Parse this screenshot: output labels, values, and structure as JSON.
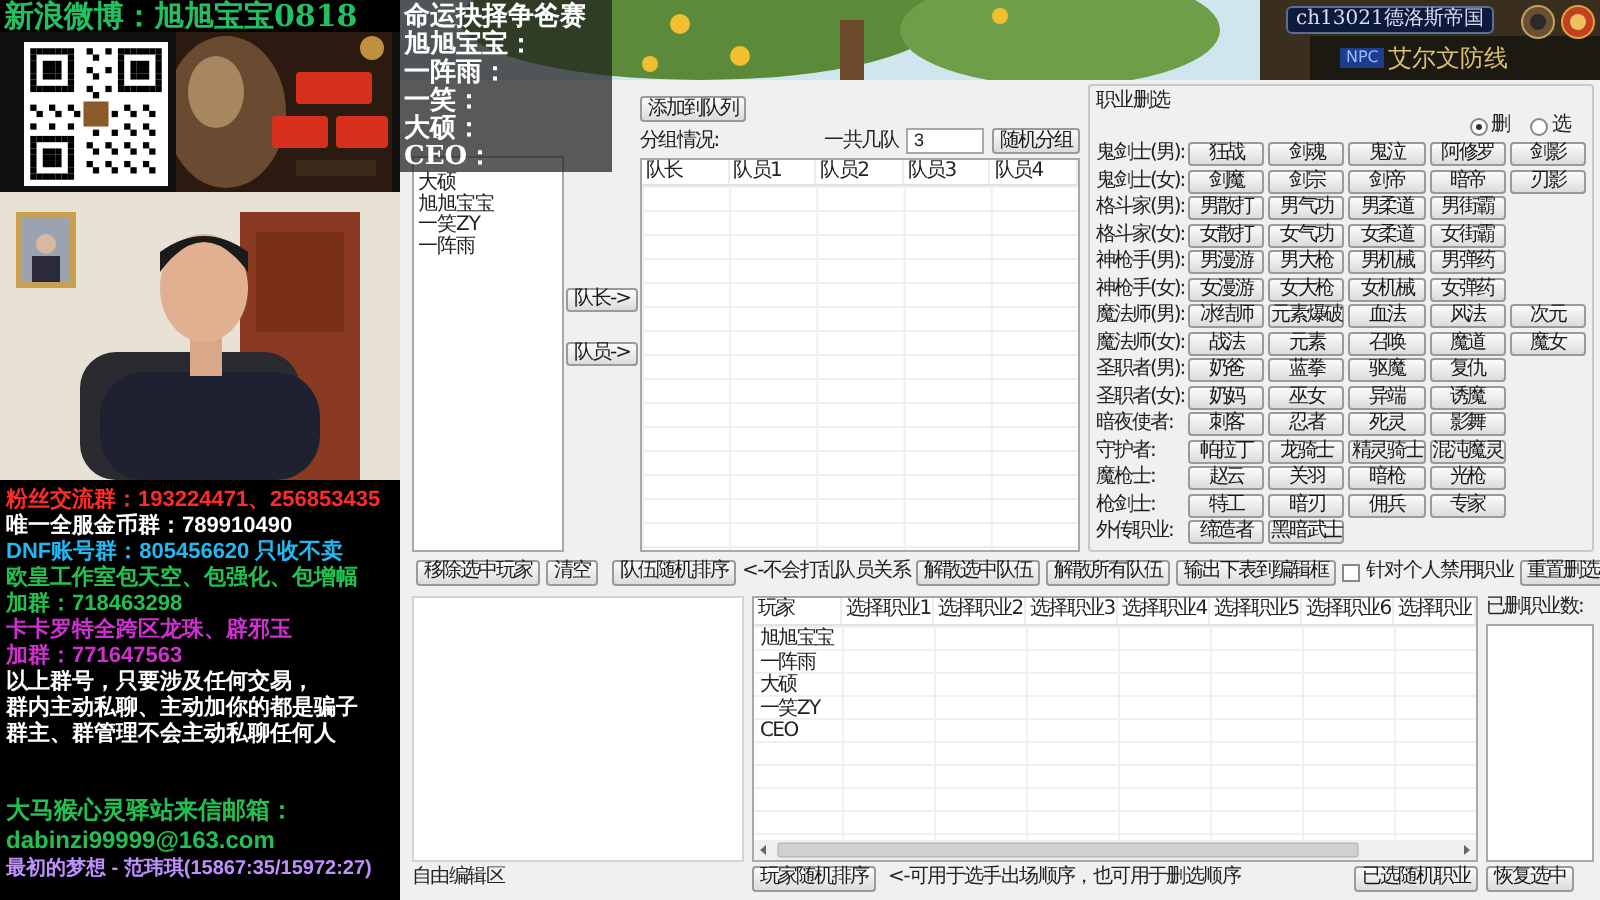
{
  "stream": {
    "banner": "新浪微博：旭旭宝宝0818",
    "info_lines": [
      {
        "text": "粉丝交流群：193224471、256853435",
        "color": "#ff2a2a"
      },
      {
        "text": "唯一全服金币群：789910490",
        "color": "#ffffff"
      },
      {
        "text": "DNF账号群：805456620 只收不卖",
        "color": "#22b8f0"
      },
      {
        "text": "欧皇工作室包天空、包强化、包增幅",
        "color": "#22c050"
      },
      {
        "text": "加群：718463298",
        "color": "#22c050"
      },
      {
        "text": "卡卡罗特全跨区龙珠、辟邪玉",
        "color": "#d030d0"
      },
      {
        "text": "加群：771647563",
        "color": "#d030d0"
      },
      {
        "text": "以上群号，只要涉及任何交易，",
        "color": "#ffffff"
      },
      {
        "text": "群内主动私聊、主动加你的都是骗子",
        "color": "#ffffff"
      },
      {
        "text": "群主、群管理不会主动私聊任何人",
        "color": "#ffffff"
      }
    ],
    "contact_lines": [
      {
        "text": "大马猴心灵驿站来信邮箱：",
        "color": "#22c050"
      },
      {
        "text": "dabinzi99999@163.com",
        "color": "#22c050"
      },
      {
        "text": "最初的梦想 - 范玮琪(15867:35/15972:27)",
        "color": "#c090ff"
      }
    ]
  },
  "scoreboard": {
    "title": "命运抉择争爸赛",
    "entries": [
      "旭旭宝宝：",
      "一阵雨：",
      "一笑：",
      "大硕：",
      "CEO："
    ]
  },
  "game_hud": {
    "channel": "ch13021德洛斯帝国",
    "npc_tag": "NPC",
    "location": "艾尔文防线"
  },
  "app": {
    "player_list": [
      "大硕",
      "旭旭宝宝",
      "一笑ZY",
      "一阵雨"
    ],
    "add_button": "添加到队列",
    "captain_button": "队长->",
    "member_button": "队员->",
    "grouping_label": "分组情况:",
    "team_count_label": "一共几队",
    "team_count": "3",
    "random_group_button": "随机分组",
    "team_table": {
      "columns": [
        "队长",
        "队员1",
        "队员2",
        "队员3",
        "队员4"
      ]
    },
    "class_filter": {
      "title": "职业删选",
      "modes": [
        {
          "label": "删",
          "selected": true
        },
        {
          "label": "选",
          "selected": false
        }
      ],
      "rows": [
        {
          "label": "鬼剑士(男):",
          "classes": [
            "狂战",
            "剑魂",
            "鬼泣",
            "阿修罗",
            "剑影"
          ]
        },
        {
          "label": "鬼剑士(女):",
          "classes": [
            "剑魔",
            "剑宗",
            "剑帝",
            "暗帝",
            "刃影"
          ]
        },
        {
          "label": "格斗家(男):",
          "classes": [
            "男散打",
            "男气功",
            "男柔道",
            "男街霸"
          ]
        },
        {
          "label": "格斗家(女):",
          "classes": [
            "女散打",
            "女气功",
            "女柔道",
            "女街霸"
          ]
        },
        {
          "label": "神枪手(男):",
          "classes": [
            "男漫游",
            "男大枪",
            "男机械",
            "男弹药"
          ]
        },
        {
          "label": "神枪手(女):",
          "classes": [
            "女漫游",
            "女大枪",
            "女机械",
            "女弹药"
          ]
        },
        {
          "label": "魔法师(男):",
          "classes": [
            "冰结师",
            "元素爆破",
            "血法",
            "风法",
            "次元"
          ]
        },
        {
          "label": "魔法师(女):",
          "classes": [
            "战法",
            "元素",
            "召唤",
            "魔道",
            "魔女"
          ]
        },
        {
          "label": "圣职者(男):",
          "classes": [
            "奶爸",
            "蓝拳",
            "驱魔",
            "复仇"
          ]
        },
        {
          "label": "圣职者(女):",
          "classes": [
            "奶妈",
            "巫女",
            "异端",
            "诱魔"
          ]
        },
        {
          "label": "暗夜使者:",
          "classes": [
            "刺客",
            "忍者",
            "死灵",
            "影舞"
          ]
        },
        {
          "label": "守护者:",
          "classes": [
            "帕拉丁",
            "龙骑士",
            "精灵骑士",
            "混沌魔灵"
          ]
        },
        {
          "label": "魔枪士:",
          "classes": [
            "赵云",
            "关羽",
            "暗枪",
            "光枪"
          ]
        },
        {
          "label": "枪剑士:",
          "classes": [
            "特工",
            "暗刃",
            "佣兵",
            "专家"
          ]
        },
        {
          "label": "外传职业:",
          "classes": [
            "缔造者",
            "黑暗武士"
          ]
        }
      ]
    },
    "actions": {
      "remove": "移除选中玩家",
      "clear": "清空",
      "shuffle_teams": "队伍随机排序",
      "shuffle_note": "<-不会打乱队员关系",
      "dissolve_selected": "解散选中队伍",
      "dissolve_all": "解散所有队伍",
      "export": "输出下表到编辑框",
      "per_player_ban": {
        "label": "针对个人禁用职业",
        "checked": false
      },
      "reset": "重置删选"
    },
    "free_edit_label": "自由编辑区",
    "player_table": {
      "columns": [
        "玩家",
        "选择职业1",
        "选择职业2",
        "选择职业3",
        "选择职业4",
        "选择职业5",
        "选择职业6",
        "选择职业"
      ],
      "rows": [
        {
          "player": "旭旭宝宝"
        },
        {
          "player": "一阵雨"
        },
        {
          "player": "大硕"
        },
        {
          "player": "一笑ZY"
        },
        {
          "player": "CEO"
        }
      ]
    },
    "banned_label": "已删职业数:",
    "bottom": {
      "shuffle_players": "玩家随机排序",
      "shuffle_note": "<-可用于选手出场顺序，也可用于删选顺序",
      "random_class": "已选随机职业",
      "restore": "恢复选中"
    }
  }
}
